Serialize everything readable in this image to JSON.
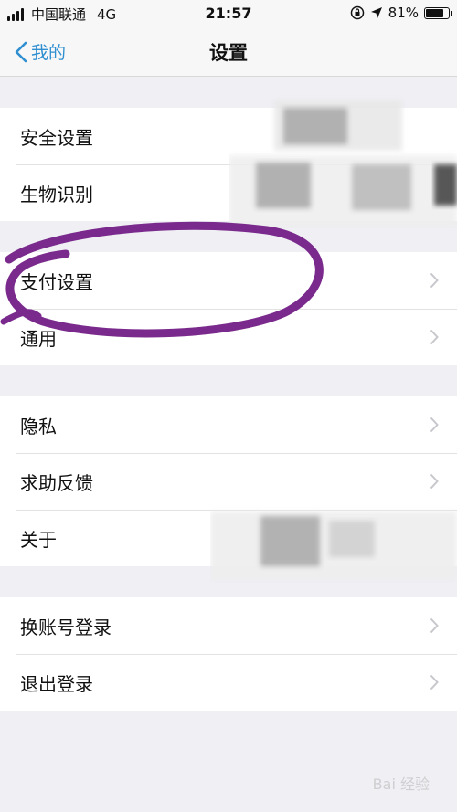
{
  "status_bar": {
    "carrier": "中国联通",
    "network": "4G",
    "time": "21:57",
    "battery": "81%",
    "battery_level": 0.81
  },
  "nav": {
    "back_label": "我的",
    "title": "设置"
  },
  "groups": [
    {
      "items": [
        {
          "label": "安全设置"
        },
        {
          "label": "生物识别"
        }
      ]
    },
    {
      "items": [
        {
          "label": "支付设置"
        },
        {
          "label": "通用"
        }
      ]
    },
    {
      "items": [
        {
          "label": "隐私"
        },
        {
          "label": "求助反馈"
        },
        {
          "label": "关于"
        }
      ]
    },
    {
      "items": [
        {
          "label": "换账号登录"
        },
        {
          "label": "退出登录"
        }
      ]
    }
  ],
  "watermark": "Bai 经验",
  "colors": {
    "accent": "#2f8fd0",
    "highlight_oval": "#7a2a8c",
    "background": "#efeff4"
  }
}
